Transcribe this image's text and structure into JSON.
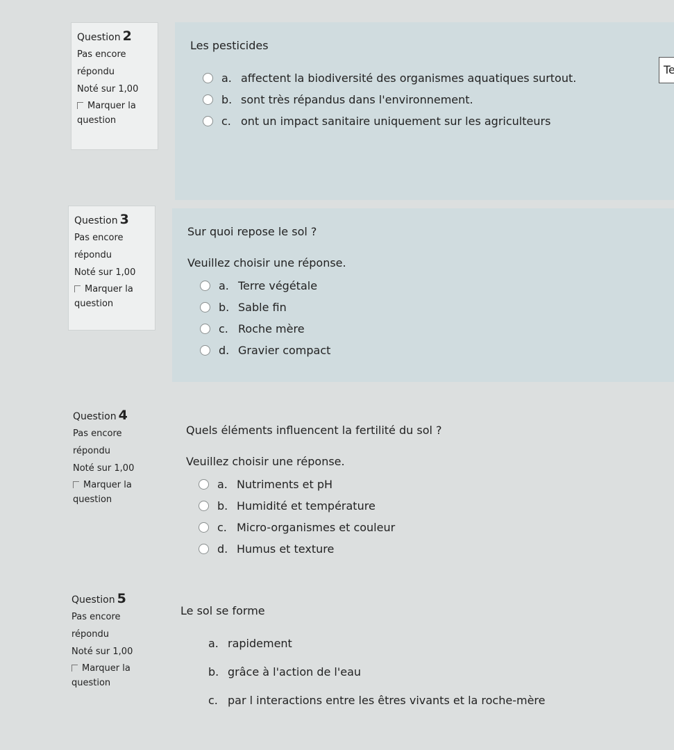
{
  "side_button": "Te",
  "questions": [
    {
      "label": "Question",
      "number": "2",
      "status": "Pas encore",
      "status2": "répondu",
      "score": "Noté sur 1,00",
      "flag1": "Marquer la",
      "flag2": "question",
      "text": "Les pesticides",
      "prompt": "",
      "answers": [
        {
          "letter": "a.",
          "text": "affectent la biodiversité des organismes aquatiques surtout."
        },
        {
          "letter": "b.",
          "text": "sont très répandus dans l'environnement."
        },
        {
          "letter": "c.",
          "text": "ont un impact sanitaire uniquement sur les agriculteurs"
        }
      ]
    },
    {
      "label": "Question",
      "number": "3",
      "status": "Pas encore",
      "status2": "répondu",
      "score": "Noté sur 1,00",
      "flag1": "Marquer la",
      "flag2": "question",
      "text": "Sur quoi repose le sol ?",
      "prompt": "Veuillez choisir une réponse.",
      "answers": [
        {
          "letter": "a.",
          "text": "Terre végétale"
        },
        {
          "letter": "b.",
          "text": "Sable fin"
        },
        {
          "letter": "c.",
          "text": "Roche mère"
        },
        {
          "letter": "d.",
          "text": "Gravier compact"
        }
      ]
    },
    {
      "label": "Question",
      "number": "4",
      "status": "Pas encore",
      "status2": "répondu",
      "score": "Noté sur 1,00",
      "flag1": "Marquer la",
      "flag2": "question",
      "text": "Quels éléments influencent la fertilité du sol ?",
      "prompt": "Veuillez choisir une réponse.",
      "answers": [
        {
          "letter": "a.",
          "text": "Nutriments et pH"
        },
        {
          "letter": "b.",
          "text": "Humidité et température"
        },
        {
          "letter": "c.",
          "text": "Micro-organismes et couleur"
        },
        {
          "letter": "d.",
          "text": "Humus et texture"
        }
      ]
    },
    {
      "label": "Question",
      "number": "5",
      "status": "Pas encore",
      "status2": "répondu",
      "score": "Noté sur 1,00",
      "flag1": "Marquer la",
      "flag2": "question",
      "text": "Le sol se forme",
      "prompt": "",
      "answers": [
        {
          "letter": "a.",
          "text": "rapidement"
        },
        {
          "letter": "b.",
          "text": "grâce à l'action de l'eau"
        },
        {
          "letter": "c.",
          "text": "par l interactions entre les êtres vivants et la roche-mère"
        }
      ]
    }
  ]
}
